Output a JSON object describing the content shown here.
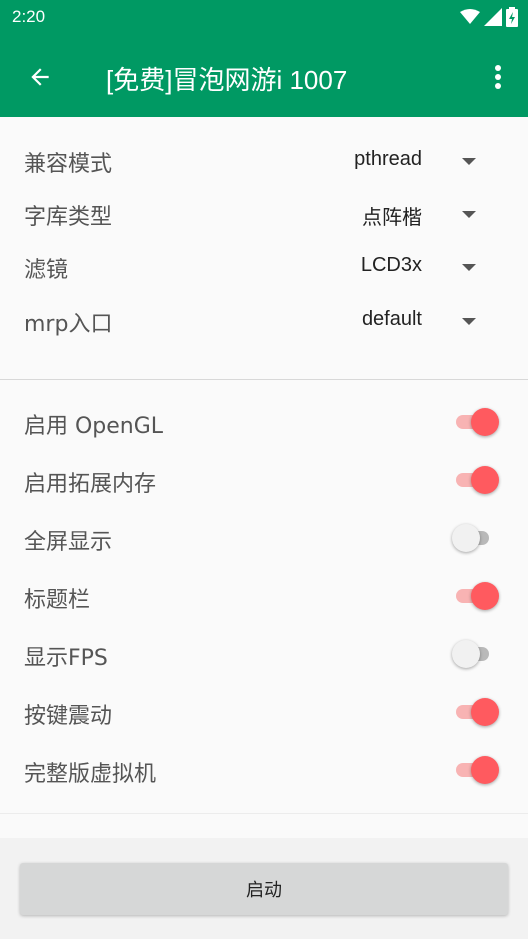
{
  "status_bar": {
    "time": "2:20"
  },
  "app_bar": {
    "title": "[免费]冒泡网游i 1007"
  },
  "selects": [
    {
      "label": "兼容模式",
      "value": "pthread"
    },
    {
      "label": "字库类型",
      "value": "点阵楷"
    },
    {
      "label": "滤镜",
      "value": "LCD3x"
    },
    {
      "label": "mrp入口",
      "value": "default"
    }
  ],
  "switches": [
    {
      "label": "启用 OpenGL",
      "checked": true
    },
    {
      "label": "启用拓展内存",
      "checked": true
    },
    {
      "label": "全屏显示",
      "checked": false
    },
    {
      "label": "标题栏",
      "checked": true
    },
    {
      "label": "显示FPS",
      "checked": false
    },
    {
      "label": "按键震动",
      "checked": true
    },
    {
      "label": "完整版虚拟机",
      "checked": true
    }
  ],
  "actions": {
    "start_label": "启动"
  },
  "colors": {
    "primary": "#009963",
    "switch_on": "#ff5a5f",
    "switch_track_on": "#f8b3b3"
  }
}
